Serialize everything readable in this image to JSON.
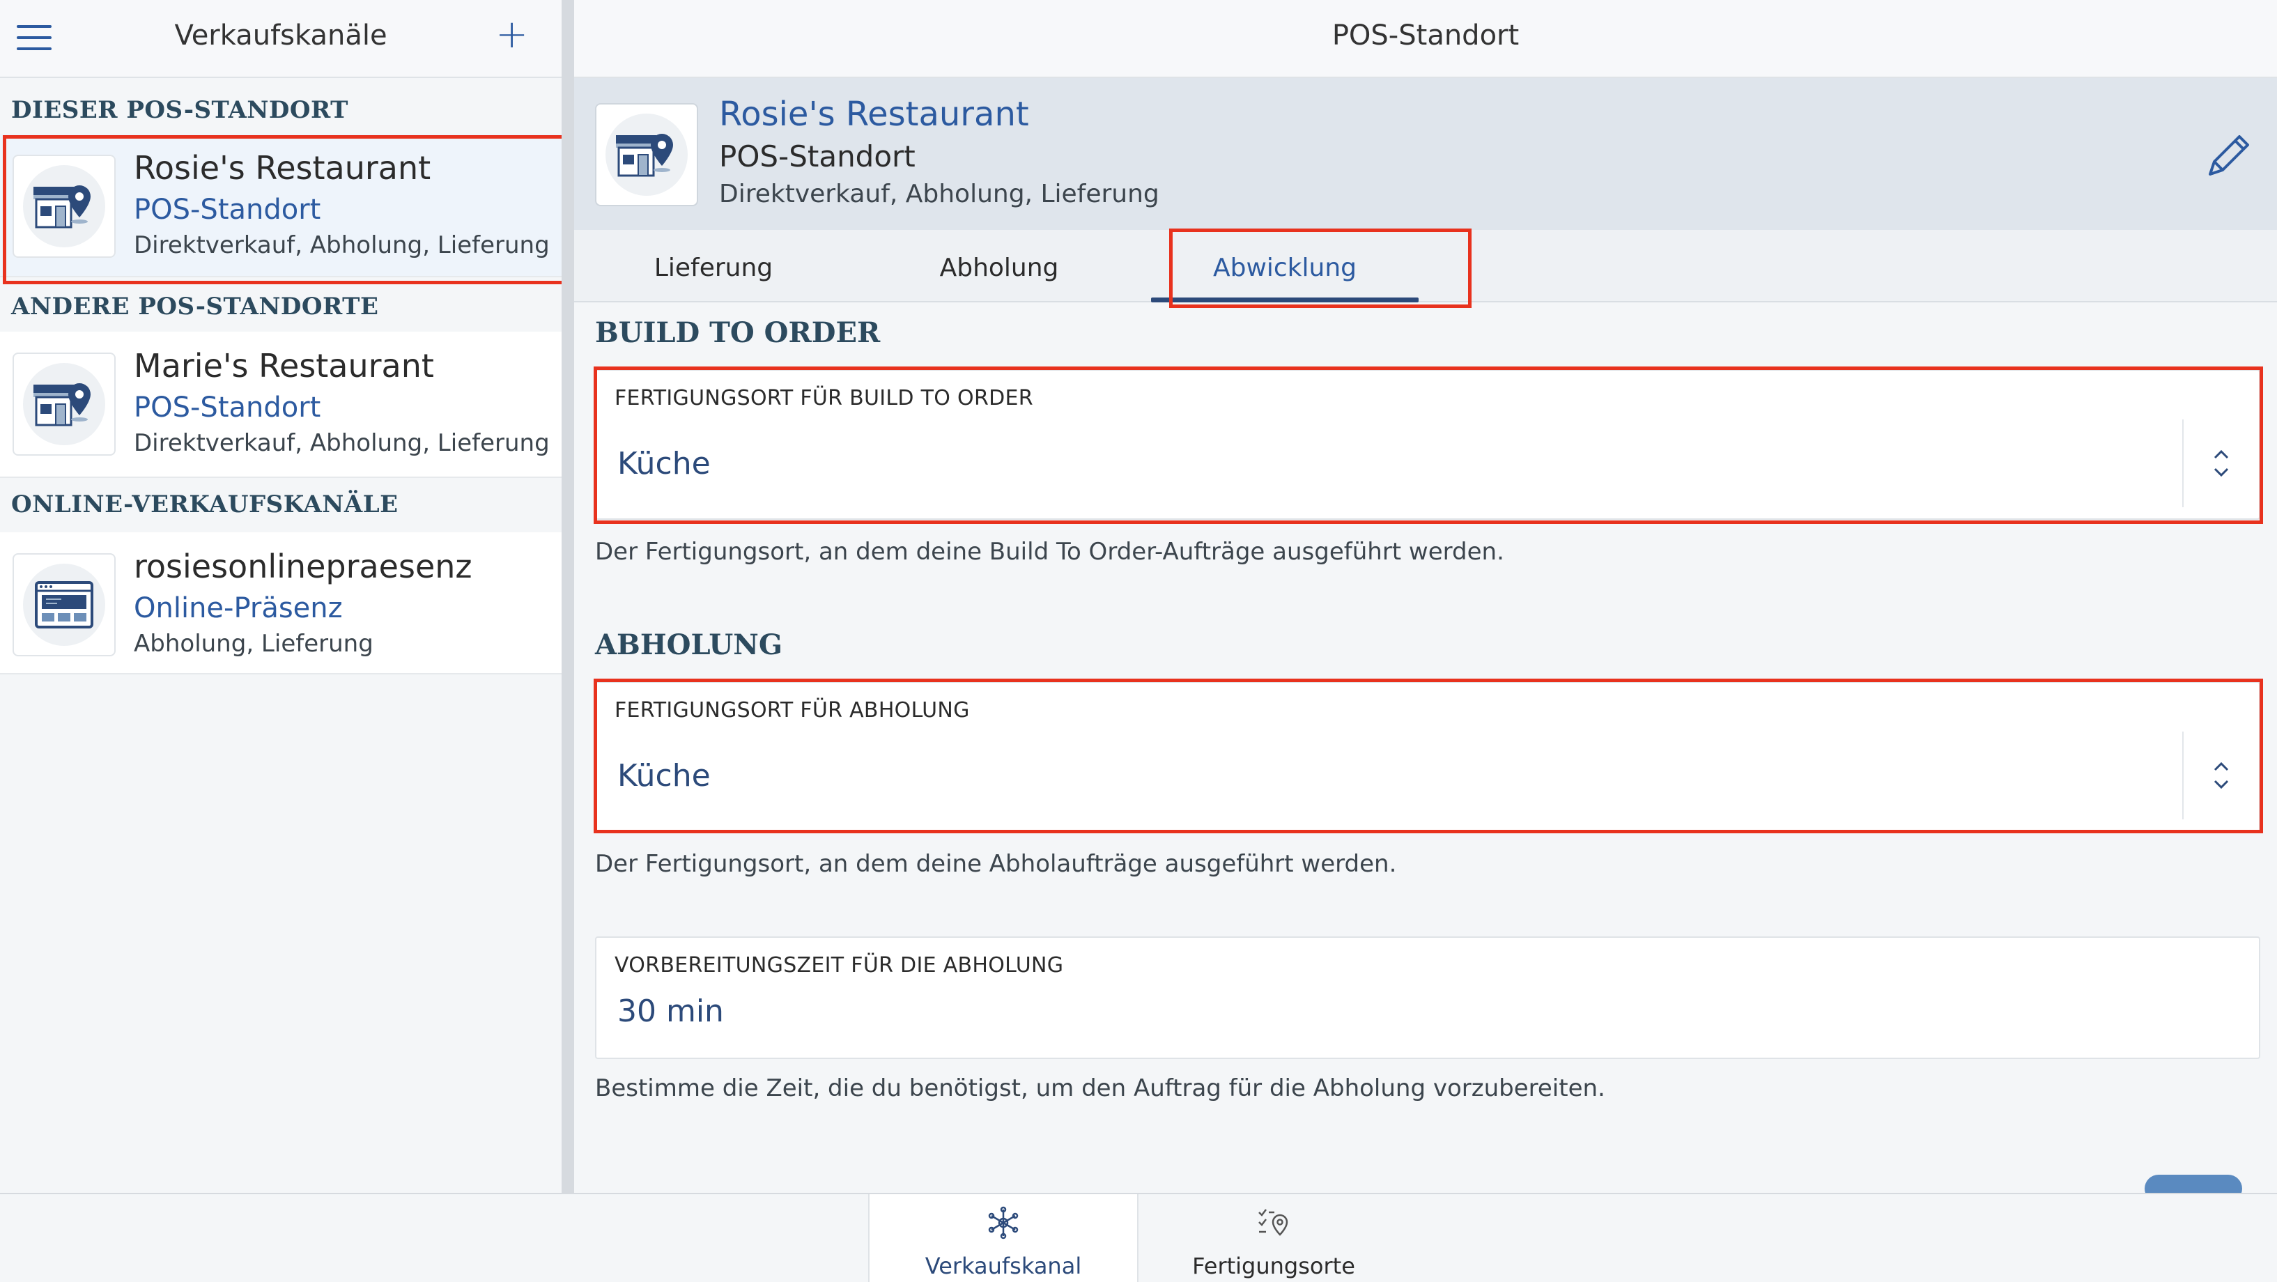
{
  "sidebar": {
    "title": "Verkaufskanäle",
    "add_label": "+",
    "sections": [
      {
        "label": "DIESER POS-STANDORT",
        "items": [
          {
            "name": "Rosie's Restaurant",
            "type": "POS-Standort",
            "modes": "Direktverkauf, Abholung, Lieferung",
            "icon": "store-location-icon"
          }
        ]
      },
      {
        "label": "ANDERE POS-STANDORTE",
        "items": [
          {
            "name": "Marie's Restaurant",
            "type": "POS-Standort",
            "modes": "Direktverkauf, Abholung, Lieferung",
            "icon": "store-location-icon"
          }
        ]
      },
      {
        "label": "ONLINE-VERKAUFSKANÄLE",
        "items": [
          {
            "name": "rosiesonlinepraesenz",
            "type": "Online-Präsenz",
            "modes": "Abholung, Lieferung",
            "icon": "web-browser-icon"
          }
        ]
      }
    ]
  },
  "main": {
    "title": "POS-Standort",
    "summary": {
      "name": "Rosie's Restaurant",
      "type": "POS-Standort",
      "modes": "Direktverkauf, Abholung, Lieferung"
    },
    "tabs": [
      {
        "label": "Lieferung"
      },
      {
        "label": "Abholung"
      },
      {
        "label": "Abwicklung"
      }
    ],
    "active_tab": "Abwicklung",
    "build_to_order": {
      "heading": "BUILD TO ORDER",
      "field_label": "FERTIGUNGSORT FÜR BUILD TO ORDER",
      "value": "Küche",
      "hint": "Der Fertigungsort, an dem deine Build To Order-Aufträge ausgeführt werden."
    },
    "pickup": {
      "heading": "ABHOLUNG",
      "field_label": "FERTIGUNGSORT FÜR ABHOLUNG",
      "value": "Küche",
      "hint": "Der Fertigungsort, an dem deine Abholaufträge ausgeführt werden."
    },
    "prep_time": {
      "field_label": "VORBEREITUNGSZEIT FÜR DIE ABHOLUNG",
      "value": "30 min",
      "hint": "Bestimme die Zeit, die du benötigst, um den Auftrag für die Abholung vorzubereiten."
    }
  },
  "bottom_nav": [
    {
      "label": "Verkaufskanal",
      "icon": "snowflake-network-icon",
      "active": true
    },
    {
      "label": "Fertigungsorte",
      "icon": "checklist-location-icon",
      "active": false
    }
  ],
  "colors": {
    "accent": "#2c5aa0",
    "highlight_outline": "#e8321e",
    "summary_bg": "#dfe5ec"
  }
}
